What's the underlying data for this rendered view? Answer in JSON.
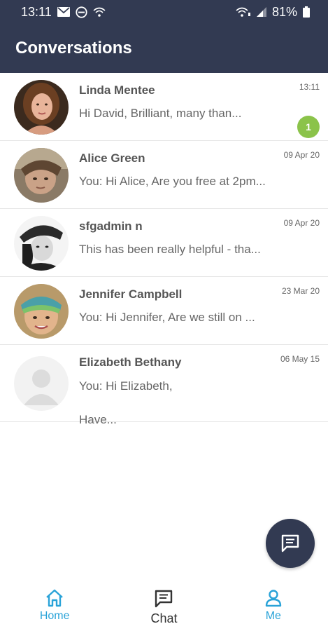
{
  "status_bar": {
    "time": "13:11",
    "battery": "81%",
    "icons": [
      "mail-icon",
      "do-not-disturb-icon",
      "wifi-icon",
      "wifi-calling-icon",
      "signal-icon",
      "battery-icon"
    ]
  },
  "header": {
    "title": "Conversations"
  },
  "conversations": [
    {
      "name": "Linda Mentee",
      "message": "Hi David, Brilliant, many than...",
      "time": "13:11",
      "unread": "1"
    },
    {
      "name": "Alice Green",
      "message": "You: Hi Alice, Are you free at 2pm...",
      "time": "09 Apr 20"
    },
    {
      "name": "sfgadmin n",
      "message": "This has been really helpful - tha...",
      "time": "09 Apr 20"
    },
    {
      "name": "Jennifer Campbell",
      "message": "You: Hi Jennifer, Are we still on ...",
      "time": "23 Mar 20"
    },
    {
      "name": "Elizabeth Bethany",
      "message": "You: Hi Elizabeth,\n\nHave...",
      "time": "06 May 15"
    }
  ],
  "fab": {
    "icon": "new-message-icon"
  },
  "bottom_nav": {
    "items": [
      {
        "label": "Home",
        "icon": "home-icon"
      },
      {
        "label": "Chat",
        "icon": "chat-icon"
      },
      {
        "label": "Me",
        "icon": "person-icon"
      }
    ]
  },
  "colors": {
    "header_bg": "#323a52",
    "accent": "#2aa3d8",
    "badge": "#8bc34a"
  }
}
